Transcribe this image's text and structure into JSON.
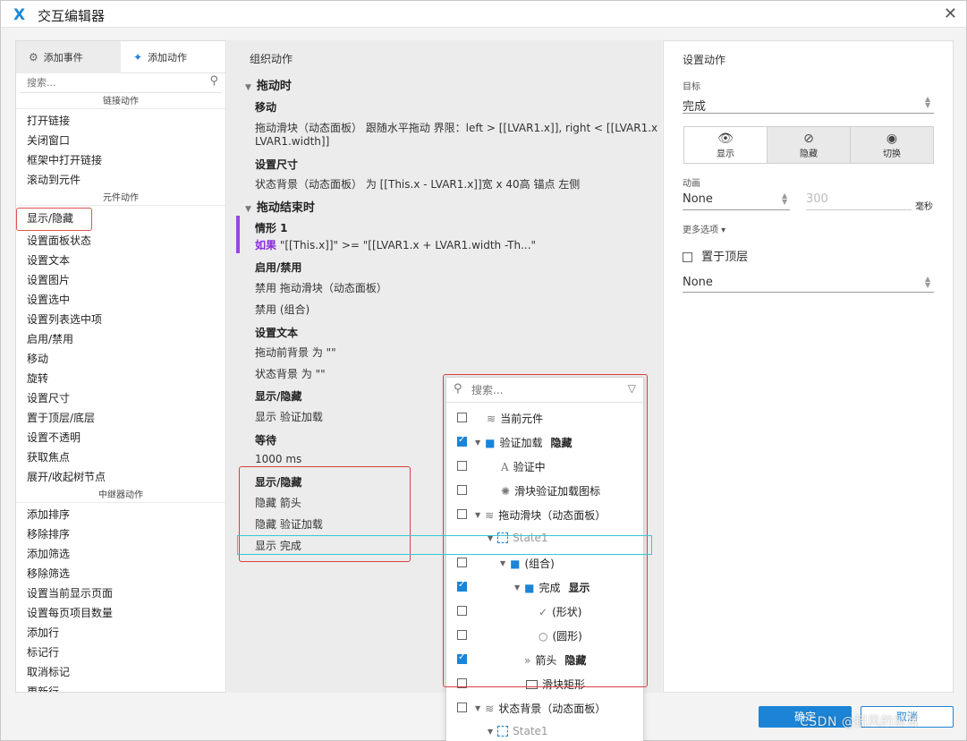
{
  "window": {
    "title": "交互编辑器",
    "close_label": "✕",
    "logo": "X"
  },
  "left": {
    "tabs": [
      {
        "label": "添加事件",
        "icon": "add-event-icon"
      },
      {
        "label": "添加动作",
        "icon": "add-action-icon"
      }
    ],
    "search_placeholder": "搜索...",
    "groups": [
      {
        "header": "链接动作",
        "items": [
          "打开链接",
          "关闭窗口",
          "框架中打开链接",
          "滚动到元件"
        ]
      },
      {
        "header": "元件动作",
        "items": [
          "显示/隐藏",
          "设置面板状态",
          "设置文本",
          "设置图片",
          "设置选中",
          "设置列表选中项",
          "启用/禁用",
          "移动",
          "旋转",
          "设置尺寸",
          "置于顶层/底层",
          "设置不透明",
          "获取焦点",
          "展开/收起树节点"
        ]
      },
      {
        "header": "中继器动作",
        "items": [
          "添加排序",
          "移除排序",
          "添加筛选",
          "移除筛选",
          "设置当前显示页面",
          "设置每页项目数量",
          "添加行",
          "标记行",
          "取消标记",
          "更新行"
        ]
      }
    ]
  },
  "middle": {
    "title": "组织动作",
    "drag": {
      "header": "拖动时",
      "move_label": "移动",
      "move_detail_1": "拖动滑块（动态面板） 跟随水平拖动 界限：left > [[LVAR1.x]], right < [[LVAR1.x +",
      "move_detail_2": "LVAR1.width]]",
      "size_label": "设置尺寸",
      "size_detail": "状态背景（动态面板） 为 [[This.x - LVAR1.x]]宽 x 40高  锚点 左侧"
    },
    "drag_end": {
      "header": "拖动结束时",
      "case_label": "情形 1",
      "if_keyword": "如果",
      "if_condition": "\"[[This.x]]\" >= \"[[LVAR1.x + LVAR1.width -Th...\"",
      "enable_label": "启用/禁用",
      "enable_1": "禁用 拖动滑块（动态面板）",
      "enable_2": "禁用 (组合)",
      "settext_label": "设置文本",
      "settext_1": "拖动前背景 为 \"\"",
      "settext_2": "状态背景 为 \"\"",
      "show_label": "显示/隐藏",
      "show_1": "显示 验证加载",
      "wait_label": "等待",
      "wait_1": "1000 ms",
      "show2_label": "显示/隐藏",
      "show2_1": "隐藏 箭头",
      "show2_2": "隐藏 验证加载",
      "show2_3": "显示 完成"
    }
  },
  "right": {
    "title": "设置动作",
    "target_label": "目标",
    "target_value": "完成",
    "visibility": [
      {
        "label": "显示",
        "icon": "eye-icon"
      },
      {
        "label": "隐藏",
        "icon": "eye-slash-icon"
      },
      {
        "label": "切换",
        "icon": "eye-toggle-icon"
      }
    ],
    "anim_label": "动画",
    "anim_value": "None",
    "duration_value": "300",
    "duration_unit": "毫秒",
    "more_options": "更多选项 ▾",
    "bring_front_label": "置于顶层",
    "light_value": "None"
  },
  "popup": {
    "search_placeholder": "搜索...",
    "rows": [
      {
        "label": "当前元件",
        "icon": "layers-icon",
        "checked": false
      },
      {
        "label": "验证加载",
        "badge": "隐藏",
        "icon": "folder-icon",
        "checked": true
      },
      {
        "label": "验证中",
        "icon": "text-icon",
        "checked": false
      },
      {
        "label": "滑块验证加载图标",
        "icon": "spinner-icon",
        "checked": false
      },
      {
        "label": "拖动滑块（动态面板）",
        "icon": "layers-icon",
        "checked": false
      },
      {
        "label": "State1",
        "icon": "state-icon"
      },
      {
        "label": "(组合)",
        "icon": "folder-icon",
        "checked": false
      },
      {
        "label": "完成",
        "badge": "显示",
        "icon": "folder-icon",
        "checked": true
      },
      {
        "label": "(形状)",
        "icon": "check-shape-icon",
        "checked": false
      },
      {
        "label": "(圆形)",
        "icon": "circle-icon",
        "checked": false
      },
      {
        "label": "箭头",
        "badge": "隐藏",
        "icon": "arrow-icon",
        "checked": true
      },
      {
        "label": "滑块矩形",
        "icon": "rect-icon",
        "checked": false
      },
      {
        "label": "状态背景（动态面板）",
        "icon": "layers-icon",
        "checked": false
      },
      {
        "label": "State1",
        "icon": "state-icon"
      }
    ]
  },
  "footer": {
    "ok_label": "确定",
    "cancel_label": "取消",
    "watermark": "CSDN @招风的黑耳"
  }
}
